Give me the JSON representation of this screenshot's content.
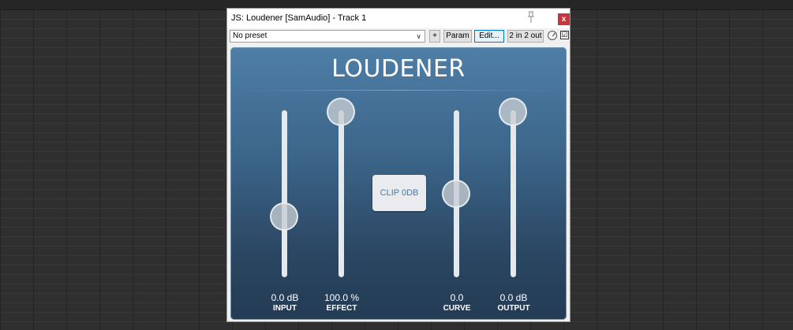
{
  "window": {
    "title": "JS: Loudener [SamAudio] - Track 1",
    "close_label": "x"
  },
  "toolbar": {
    "preset_value": "No preset",
    "add_label": "+",
    "param_label": "Param",
    "edit_label": "Edit...",
    "io_label": "2 in 2 out",
    "bypass_checked": "☑"
  },
  "plugin": {
    "title": "LOUDENER",
    "clip_label": "CLIP 0DB",
    "sliders": [
      {
        "value": "0.0 dB",
        "label": "INPUT",
        "fraction": 0.36
      },
      {
        "value": "100.0 %",
        "label": "EFFECT",
        "fraction": 1.0
      },
      {
        "value": "0.0",
        "label": "CURVE",
        "fraction": 0.5
      },
      {
        "value": "0.0 dB",
        "label": "OUTPUT",
        "fraction": 1.0
      }
    ]
  },
  "colors": {
    "close": "#c8353b",
    "panel_top": "#4e7ea7",
    "panel_bottom": "#243b53",
    "clip_text": "#4b78a4"
  }
}
